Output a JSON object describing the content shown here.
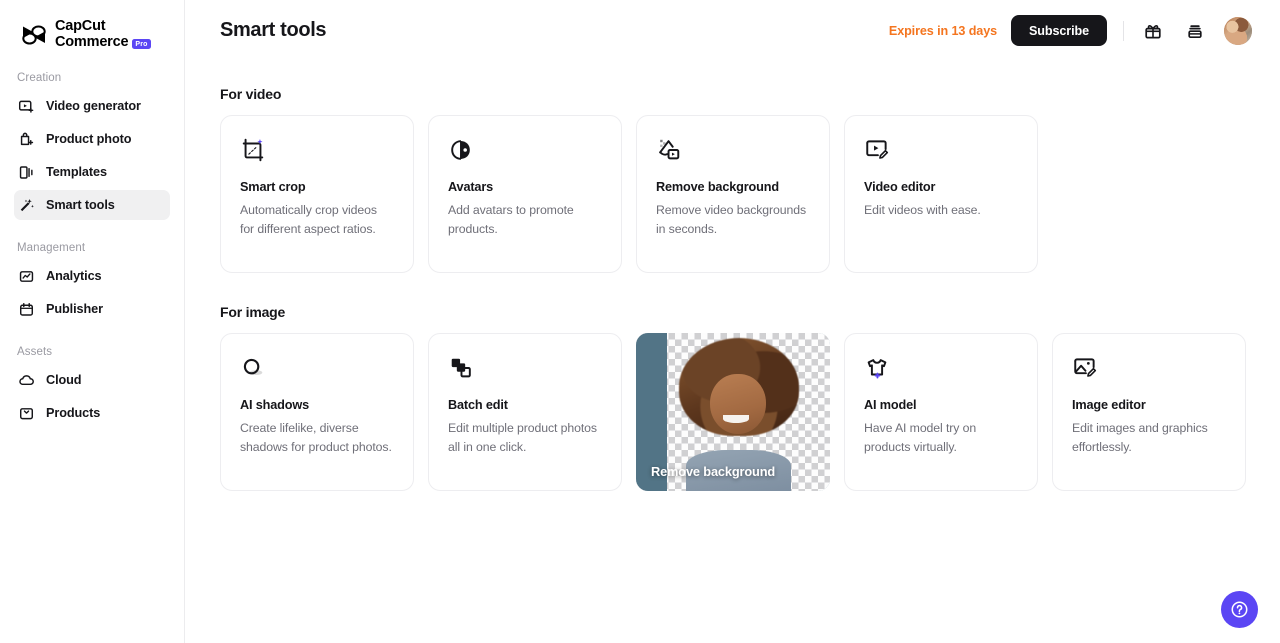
{
  "sidebar": {
    "logo": {
      "line1": "CapCut",
      "line2": "Commerce",
      "badge": "Pro"
    },
    "sections": [
      {
        "title": "Creation",
        "items": [
          {
            "label": "Video generator",
            "icon": "video-generator-icon",
            "active": false
          },
          {
            "label": "Product photo",
            "icon": "product-photo-icon",
            "active": false
          },
          {
            "label": "Templates",
            "icon": "templates-icon",
            "active": false
          },
          {
            "label": "Smart tools",
            "icon": "magic-wand-icon",
            "active": true
          }
        ]
      },
      {
        "title": "Management",
        "items": [
          {
            "label": "Analytics",
            "icon": "analytics-icon",
            "active": false
          },
          {
            "label": "Publisher",
            "icon": "publisher-icon",
            "active": false
          }
        ]
      },
      {
        "title": "Assets",
        "items": [
          {
            "label": "Cloud",
            "icon": "cloud-icon",
            "active": false
          },
          {
            "label": "Products",
            "icon": "products-icon",
            "active": false
          }
        ]
      }
    ]
  },
  "header": {
    "title": "Smart tools",
    "expires_text": "Expires in 13 days",
    "expires_color": "#f4751f",
    "subscribe_label": "Subscribe",
    "gift_icon": "gift-icon",
    "stack_icon": "stack-icon",
    "avatar": "user-avatar"
  },
  "sections": [
    {
      "heading": "For video",
      "cards": [
        {
          "title": "Smart crop",
          "desc": "Automatically crop videos for different aspect ratios.",
          "icon": "smart-crop-icon"
        },
        {
          "title": "Avatars",
          "desc": "Add avatars to promote products.",
          "icon": "avatar-face-icon"
        },
        {
          "title": "Remove background",
          "desc": "Remove video backgrounds in seconds.",
          "icon": "remove-background-video-icon"
        },
        {
          "title": "Video editor",
          "desc": "Edit videos with ease.",
          "icon": "video-editor-icon"
        }
      ]
    },
    {
      "heading": "For image",
      "cards": [
        {
          "title": "AI shadows",
          "desc": "Create lifelike, diverse shadows for product photos.",
          "icon": "ai-shadows-icon"
        },
        {
          "title": "Batch edit",
          "desc": "Edit multiple product photos all in one click.",
          "icon": "batch-edit-icon"
        },
        {
          "title": "Remove background",
          "desc": "",
          "icon": "photo-thumbnail",
          "is_photo": true
        },
        {
          "title": "AI model",
          "desc": "Have AI model try on products virtually.",
          "icon": "ai-model-icon"
        },
        {
          "title": "Image editor",
          "desc": "Edit images and graphics effortlessly.",
          "icon": "image-editor-icon"
        }
      ]
    }
  ],
  "help": {
    "icon": "help-question-icon",
    "color": "#5b46f4"
  }
}
